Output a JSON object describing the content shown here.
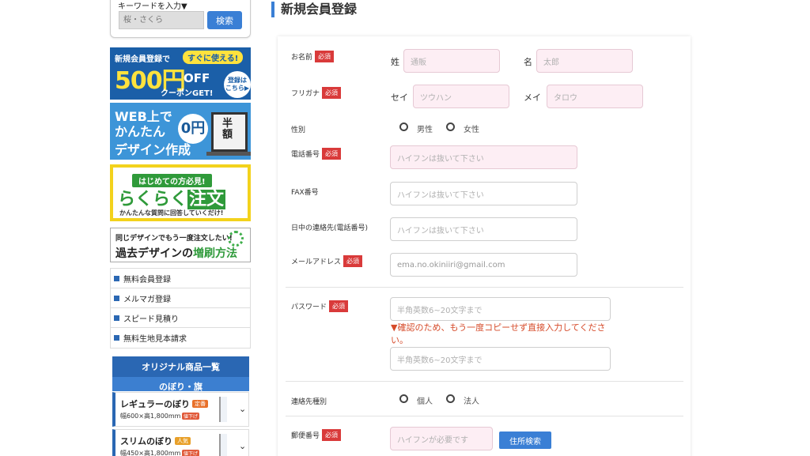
{
  "search": {
    "label": "キーワードを入力▼",
    "placeholder": "桜・さくら",
    "button": "検索"
  },
  "banners": {
    "coupon": {
      "line1": "新規会員登録で",
      "pill": "すぐに使える!",
      "amount": "500円",
      "off": "OFF",
      "get": "クーポンGET!",
      "circle": "登録は こちら▶"
    },
    "design": {
      "line1": "WEB上で",
      "line2": "かんたん",
      "line3": "デザイン作成",
      "price": "0円",
      "half": "半額"
    },
    "easy_order": {
      "tag": "はじめての方必見!",
      "title_a": "らくらく",
      "title_b": "注文",
      "sub": "かんたんな質問に回答していくだけ!"
    },
    "reprint": {
      "line1": "同じデザインでもう一度注文したい!",
      "line2a": "過去デザインの",
      "line2b": "増刷方法"
    }
  },
  "sidebar_links": [
    {
      "label": "無料会員登録"
    },
    {
      "label": "メルマガ登録"
    },
    {
      "label": "スピード見積り"
    },
    {
      "label": "無料生地見本請求"
    }
  ],
  "products": {
    "header": "オリジナル商品一覧",
    "subheader": "のぼり・旗",
    "items": [
      {
        "name": "レギュラーのぼり",
        "tag": "定番",
        "tag_color": "#e8702a",
        "size": "幅600×高1,800mm",
        "tag2": "値下げ"
      },
      {
        "name": "スリムのぼり",
        "tag": "人気",
        "tag_color": "#e8a02a",
        "size": "幅450×高1,800mm",
        "tag2": "値下げ"
      }
    ]
  },
  "form": {
    "title": "新規会員登録",
    "required_badge": "必須",
    "name": {
      "label": "お名前",
      "last_label": "姓",
      "last_placeholder": "通販",
      "first_label": "名",
      "first_placeholder": "太郎"
    },
    "kana": {
      "label": "フリガナ",
      "last_label": "セイ",
      "last_placeholder": "ツウハン",
      "first_label": "メイ",
      "first_placeholder": "タロウ"
    },
    "gender": {
      "label": "性別",
      "options": [
        "男性",
        "女性"
      ]
    },
    "phone": {
      "label": "電話番号",
      "placeholder": "ハイフンは抜いて下さい"
    },
    "fax": {
      "label": "FAX番号",
      "placeholder": "ハイフンは抜いて下さい"
    },
    "daytime": {
      "label": "日中の連絡先(電話番号)",
      "placeholder": "ハイフンは抜いて下さい"
    },
    "email": {
      "label": "メールアドレス",
      "value": "ema.no.okiniiri@gmail.com"
    },
    "password": {
      "label": "パスワード",
      "placeholder": "半角英数6~20文字まで",
      "warning": "▼確認のため、もう一度コピーせず直接入力してください。",
      "confirm_placeholder": "半角英数6~20文字まで"
    },
    "contact_type": {
      "label": "連絡先種別",
      "options": [
        "個人",
        "法人"
      ]
    },
    "zip": {
      "label": "郵便番号",
      "placeholder": "ハイフンが必要です",
      "button": "住所検索"
    }
  },
  "colors": {
    "accent": "#3a7fd5",
    "required": "#d93a3a",
    "warning": "#d64b2a",
    "field_pink": "#fdeef4"
  }
}
